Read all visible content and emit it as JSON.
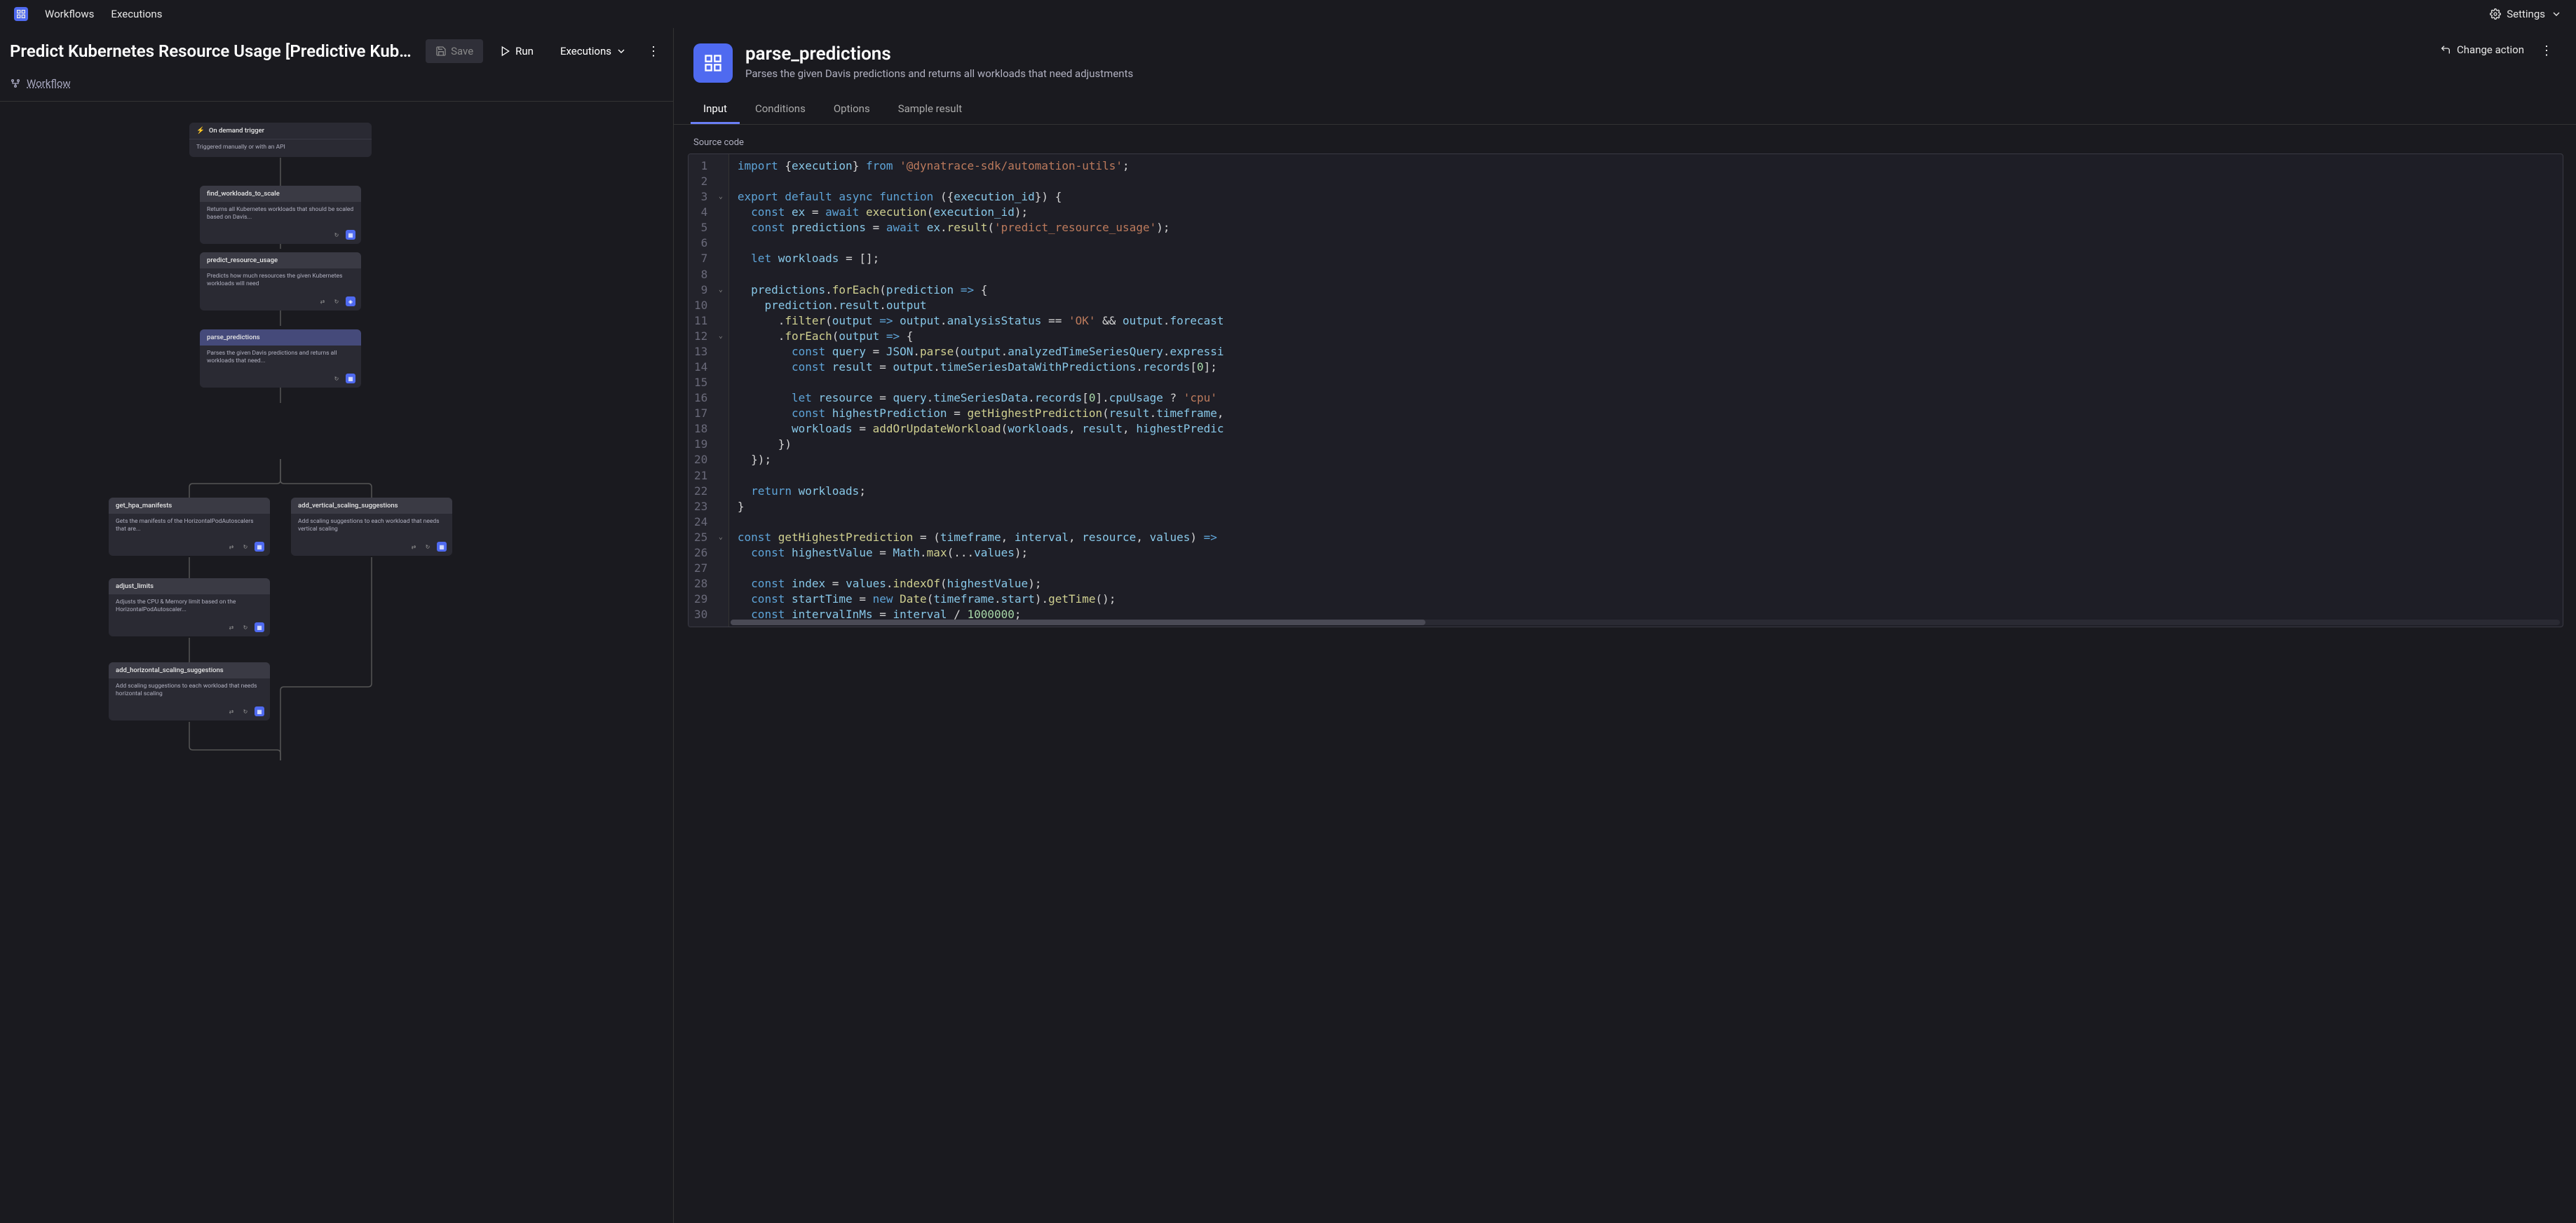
{
  "nav": {
    "workflows": "Workflows",
    "executions": "Executions"
  },
  "settings_label": "Settings",
  "workflow": {
    "title": "Predict Kubernetes Resource Usage [Predictive Kubernetes Scal...",
    "save": "Save",
    "run": "Run",
    "executions": "Executions",
    "breadcrumb": "Workflow"
  },
  "nodes": {
    "trigger": {
      "title": "On demand trigger",
      "desc": "Triggered manually or with an API"
    },
    "find": {
      "title": "find_workloads_to_scale",
      "desc": "Returns all Kubernetes workloads that should be scaled based on Davis..."
    },
    "predict": {
      "title": "predict_resource_usage",
      "desc": "Predicts how much resources the given Kubernetes workloads will need"
    },
    "parse": {
      "title": "parse_predictions",
      "desc": "Parses the given Davis predictions and returns all workloads that need..."
    },
    "get_hpa": {
      "title": "get_hpa_manifests",
      "desc": "Gets the manifests of the HorizontalPodAutoscalers that are..."
    },
    "add_vert": {
      "title": "add_vertical_scaling_suggestions",
      "desc": "Add scaling suggestions to each workload that needs vertical scaling"
    },
    "adjust": {
      "title": "adjust_limits",
      "desc": "Adjusts the CPU & Memory limit based on the HorizontalPodAutoscaler..."
    },
    "add_horiz": {
      "title": "add_horizontal_scaling_suggestions",
      "desc": "Add scaling suggestions to each workload that needs horizontal scaling"
    }
  },
  "panel": {
    "title": "parse_predictions",
    "subtitle": "Parses the given Davis predictions and returns all workloads that need adjustments",
    "change_action": "Change action",
    "tabs": {
      "input": "Input",
      "conditions": "Conditions",
      "options": "Options",
      "sample": "Sample result"
    },
    "source_label": "Source code"
  },
  "code": {
    "lines": [
      {
        "n": 1,
        "html": "<span class='tok-kw'>import</span> <span class='tok-pl'>{</span><span class='tok-id'>execution</span><span class='tok-pl'>}</span> <span class='tok-kw'>from</span> <span class='tok-str'>'@dynatrace-sdk/automation-utils'</span><span class='tok-pl'>;</span>"
      },
      {
        "n": 2,
        "html": ""
      },
      {
        "n": 3,
        "fold": true,
        "html": "<span class='tok-kw'>export</span> <span class='tok-kw'>default</span> <span class='tok-kw'>async</span> <span class='tok-kw'>function</span> <span class='tok-pl'>({</span><span class='tok-id'>execution_id</span><span class='tok-pl'>}) {</span>"
      },
      {
        "n": 4,
        "html": "  <span class='tok-kw'>const</span> <span class='tok-id'>ex</span> <span class='tok-pl'>=</span> <span class='tok-kw'>await</span> <span class='tok-fn'>execution</span><span class='tok-pl'>(</span><span class='tok-id'>execution_id</span><span class='tok-pl'>);</span>"
      },
      {
        "n": 5,
        "html": "  <span class='tok-kw'>const</span> <span class='tok-id'>predictions</span> <span class='tok-pl'>=</span> <span class='tok-kw'>await</span> <span class='tok-id'>ex</span><span class='tok-pl'>.</span><span class='tok-fn'>result</span><span class='tok-pl'>(</span><span class='tok-str'>'predict_resource_usage'</span><span class='tok-pl'>);</span>"
      },
      {
        "n": 6,
        "html": ""
      },
      {
        "n": 7,
        "html": "  <span class='tok-kw'>let</span> <span class='tok-id'>workloads</span> <span class='tok-pl'>= [];</span>"
      },
      {
        "n": 8,
        "html": ""
      },
      {
        "n": 9,
        "fold": true,
        "html": "  <span class='tok-id'>predictions</span><span class='tok-pl'>.</span><span class='tok-fn'>forEach</span><span class='tok-pl'>(</span><span class='tok-id'>prediction</span> <span class='tok-kw'>=&gt;</span> <span class='tok-pl'>{</span>"
      },
      {
        "n": 10,
        "html": "    <span class='tok-id'>prediction</span><span class='tok-pl'>.</span><span class='tok-id'>result</span><span class='tok-pl'>.</span><span class='tok-id'>output</span>"
      },
      {
        "n": 11,
        "html": "      <span class='tok-pl'>.</span><span class='tok-fn'>filter</span><span class='tok-pl'>(</span><span class='tok-id'>output</span> <span class='tok-kw'>=&gt;</span> <span class='tok-id'>output</span><span class='tok-pl'>.</span><span class='tok-id'>analysisStatus</span> <span class='tok-pl'>==</span> <span class='tok-str'>'OK'</span> <span class='tok-pl'>&amp;&amp;</span> <span class='tok-id'>output</span><span class='tok-pl'>.</span><span class='tok-id'>forecast</span>"
      },
      {
        "n": 12,
        "fold": true,
        "html": "      <span class='tok-pl'>.</span><span class='tok-fn'>forEach</span><span class='tok-pl'>(</span><span class='tok-id'>output</span> <span class='tok-kw'>=&gt;</span> <span class='tok-pl'>{</span>"
      },
      {
        "n": 13,
        "html": "        <span class='tok-kw'>const</span> <span class='tok-id'>query</span> <span class='tok-pl'>=</span> <span class='tok-id'>JSON</span><span class='tok-pl'>.</span><span class='tok-fn'>parse</span><span class='tok-pl'>(</span><span class='tok-id'>output</span><span class='tok-pl'>.</span><span class='tok-id'>analyzedTimeSeriesQuery</span><span class='tok-pl'>.</span><span class='tok-id'>expressi</span>"
      },
      {
        "n": 14,
        "html": "        <span class='tok-kw'>const</span> <span class='tok-id'>result</span> <span class='tok-pl'>=</span> <span class='tok-id'>output</span><span class='tok-pl'>.</span><span class='tok-id'>timeSeriesDataWithPredictions</span><span class='tok-pl'>.</span><span class='tok-id'>records</span><span class='tok-pl'>[</span><span class='tok-num'>0</span><span class='tok-pl'>];</span>"
      },
      {
        "n": 15,
        "html": ""
      },
      {
        "n": 16,
        "html": "        <span class='tok-kw'>let</span> <span class='tok-id'>resource</span> <span class='tok-pl'>=</span> <span class='tok-id'>query</span><span class='tok-pl'>.</span><span class='tok-id'>timeSeriesData</span><span class='tok-pl'>.</span><span class='tok-id'>records</span><span class='tok-pl'>[</span><span class='tok-num'>0</span><span class='tok-pl'>].</span><span class='tok-id'>cpuUsage</span> <span class='tok-pl'>?</span> <span class='tok-str'>'cpu'</span>"
      },
      {
        "n": 17,
        "html": "        <span class='tok-kw'>const</span> <span class='tok-id'>highestPrediction</span> <span class='tok-pl'>=</span> <span class='tok-fn'>getHighestPrediction</span><span class='tok-pl'>(</span><span class='tok-id'>result</span><span class='tok-pl'>.</span><span class='tok-id'>timeframe</span><span class='tok-pl'>,</span>"
      },
      {
        "n": 18,
        "html": "        <span class='tok-id'>workloads</span> <span class='tok-pl'>=</span> <span class='tok-fn'>addOrUpdateWorkload</span><span class='tok-pl'>(</span><span class='tok-id'>workloads</span><span class='tok-pl'>,</span> <span class='tok-id'>result</span><span class='tok-pl'>,</span> <span class='tok-id'>highestPredic</span>"
      },
      {
        "n": 19,
        "html": "      <span class='tok-pl'>})</span>"
      },
      {
        "n": 20,
        "html": "  <span class='tok-pl'>});</span>"
      },
      {
        "n": 21,
        "html": ""
      },
      {
        "n": 22,
        "html": "  <span class='tok-kw'>return</span> <span class='tok-id'>workloads</span><span class='tok-pl'>;</span>"
      },
      {
        "n": 23,
        "html": "<span class='tok-pl'>}</span>"
      },
      {
        "n": 24,
        "html": ""
      },
      {
        "n": 25,
        "fold": true,
        "html": "<span class='tok-kw'>const</span> <span class='tok-fn'>getHighestPrediction</span> <span class='tok-pl'>= (</span><span class='tok-id'>timeframe</span><span class='tok-pl'>,</span> <span class='tok-id'>interval</span><span class='tok-pl'>,</span> <span class='tok-id'>resource</span><span class='tok-pl'>,</span> <span class='tok-id'>values</span><span class='tok-pl'>)</span> <span class='tok-kw'>=&gt;</span>"
      },
      {
        "n": 26,
        "html": "  <span class='tok-kw'>const</span> <span class='tok-id'>highestValue</span> <span class='tok-pl'>=</span> <span class='tok-id'>Math</span><span class='tok-pl'>.</span><span class='tok-fn'>max</span><span class='tok-pl'>(...</span><span class='tok-id'>values</span><span class='tok-pl'>);</span>"
      },
      {
        "n": 27,
        "html": ""
      },
      {
        "n": 28,
        "html": "  <span class='tok-kw'>const</span> <span class='tok-id'>index</span> <span class='tok-pl'>=</span> <span class='tok-id'>values</span><span class='tok-pl'>.</span><span class='tok-fn'>indexOf</span><span class='tok-pl'>(</span><span class='tok-id'>highestValue</span><span class='tok-pl'>);</span>"
      },
      {
        "n": 29,
        "html": "  <span class='tok-kw'>const</span> <span class='tok-id'>startTime</span> <span class='tok-pl'>=</span> <span class='tok-kw'>new</span> <span class='tok-fn'>Date</span><span class='tok-pl'>(</span><span class='tok-id'>timeframe</span><span class='tok-pl'>.</span><span class='tok-id'>start</span><span class='tok-pl'>).</span><span class='tok-fn'>getTime</span><span class='tok-pl'>();</span>"
      },
      {
        "n": 30,
        "html": "  <span class='tok-kw'>const</span> <span class='tok-id'>intervalInMs</span> <span class='tok-pl'>=</span> <span class='tok-id'>interval</span> <span class='tok-pl'>/</span> <span class='tok-num'>1000000</span><span class='tok-pl'>;</span>"
      }
    ]
  }
}
